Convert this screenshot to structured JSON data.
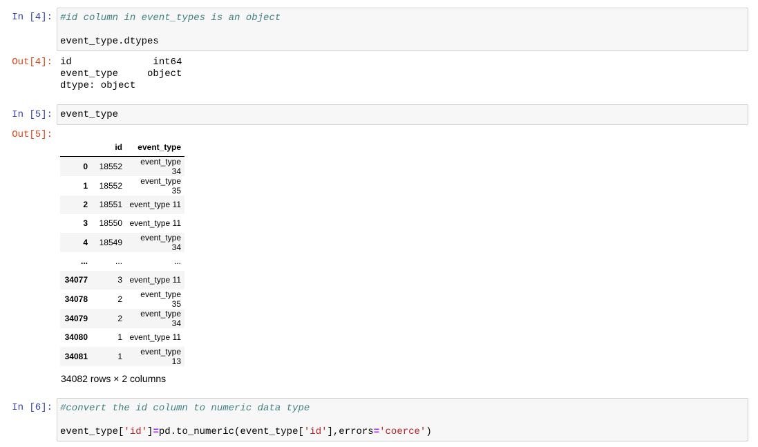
{
  "cells": {
    "c4": {
      "in_prompt": "In [4]:",
      "line1_comment": "#id column in event_types is an object",
      "line2": "event_type.dtypes",
      "out_prompt": "Out[4]:",
      "out_lines": [
        "id              int64",
        "event_type     object",
        "dtype: object"
      ]
    },
    "c5": {
      "in_prompt": "In [5]:",
      "code": "event_type",
      "out_prompt": "Out[5]:",
      "table": {
        "headers": [
          "",
          "id",
          "event_type"
        ],
        "rows": [
          [
            "0",
            "18552",
            "event_type 34"
          ],
          [
            "1",
            "18552",
            "event_type 35"
          ],
          [
            "2",
            "18551",
            "event_type 11"
          ],
          [
            "3",
            "18550",
            "event_type 11"
          ],
          [
            "4",
            "18549",
            "event_type 34"
          ],
          [
            "...",
            "...",
            "..."
          ],
          [
            "34077",
            "3",
            "event_type 11"
          ],
          [
            "34078",
            "2",
            "event_type 35"
          ],
          [
            "34079",
            "2",
            "event_type 34"
          ],
          [
            "34080",
            "1",
            "event_type 11"
          ],
          [
            "34081",
            "1",
            "event_type 13"
          ]
        ]
      },
      "shape_text": "34082 rows × 2 columns"
    },
    "c6": {
      "in_prompt": "In [6]:",
      "line1_comment": "#convert the id column to numeric data type",
      "line2_parts": {
        "a": "event_type[",
        "s1": "'id'",
        "b": "]",
        "eq": "=",
        "c": "pd.to_numeric(event_type[",
        "s2": "'id'",
        "d": "],errors",
        "eq2": "=",
        "s3": "'coerce'",
        "e": ")"
      }
    }
  },
  "colors": {
    "in_prompt": "#303f9f",
    "out_prompt": "#d84315",
    "comment": "#408080",
    "string": "#ba2121",
    "operator": "#aa22ff",
    "input_bg": "#f7f7f7",
    "input_border": "#cfcfcf"
  }
}
